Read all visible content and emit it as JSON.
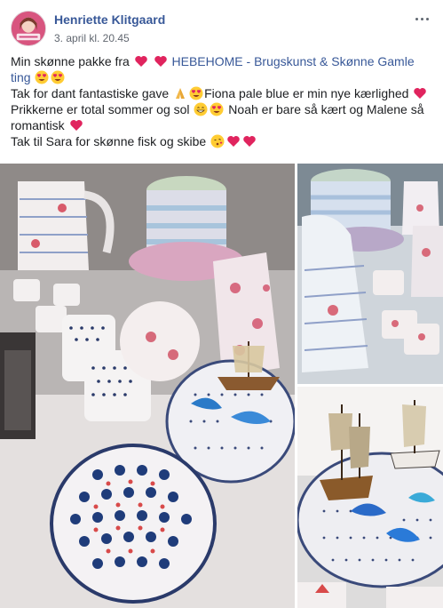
{
  "post": {
    "author": "Henriette Klitgaard",
    "timestamp": "3. april kl. 20.45",
    "text": {
      "line1_before": "Min skønne pakke fra ",
      "line1_link": "HEBEHOME - Brugskunst & Skønne Gamle ting",
      "line2_before": "Tak for dant fantastiske gave ",
      "line2_mid": "Fiona pale blue er min nye kærlighed ",
      "line3": "Prikkerne er total sommer og sol ",
      "line3_b": " Noah er bare så kært og Malene så romantisk ",
      "line4": "Tak til Sara for skønne fisk og skibe "
    }
  },
  "photos": [
    {
      "label": "Main photo of pottery"
    },
    {
      "label": "Photo of jugs and cups"
    },
    {
      "label": "Photo of ship figurines"
    }
  ],
  "icons": {
    "more": "more-options-icon",
    "heart": "red-heart-icon",
    "heart_eyes": "heart-eyes-emoji-icon",
    "pray": "folded-hands-icon",
    "grin": "grinning-face-icon",
    "kiss": "kissing-face-icon"
  },
  "colors": {
    "link": "#385898",
    "heart": "#e0245e"
  }
}
